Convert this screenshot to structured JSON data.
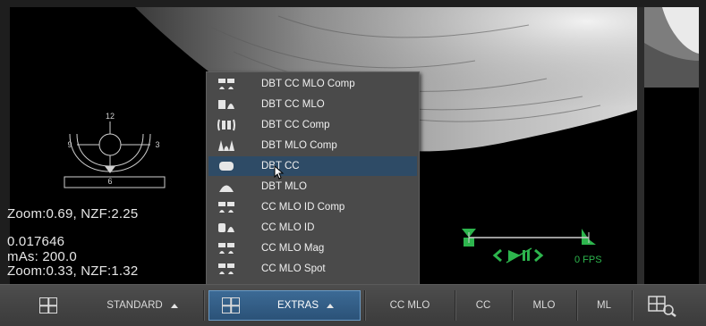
{
  "viewer": {
    "overlay": {
      "zoom_top": "Zoom:0.69, NZF:2.25",
      "value": "0.017646",
      "mas": "mAs: 200.0",
      "zoom_bottom": "Zoom:0.33, NZF:1.32"
    },
    "orientation": {
      "label_12": "12",
      "label_9": "9",
      "label_3": "3",
      "label_6": "6"
    },
    "cine": {
      "fps": "0 FPS",
      "accent": "#2db54d"
    }
  },
  "menu": {
    "highlight_color": "#2e4b66",
    "items": [
      {
        "label": "DBT CC MLO Comp",
        "icon": "hanging-protocol-icon"
      },
      {
        "label": "DBT CC MLO",
        "icon": "hanging-protocol-icon"
      },
      {
        "label": "DBT CC Comp",
        "icon": "hanging-protocol-icon"
      },
      {
        "label": "DBT MLO Comp",
        "icon": "hanging-protocol-icon"
      },
      {
        "label": "DBT CC",
        "icon": "hanging-protocol-icon",
        "highlighted": true
      },
      {
        "label": "DBT MLO",
        "icon": "hanging-protocol-icon"
      },
      {
        "label": "CC MLO ID Comp",
        "icon": "hanging-protocol-icon"
      },
      {
        "label": "CC MLO ID",
        "icon": "hanging-protocol-icon"
      },
      {
        "label": "CC MLO Mag",
        "icon": "hanging-protocol-icon"
      },
      {
        "label": "CC MLO Spot",
        "icon": "hanging-protocol-icon"
      }
    ]
  },
  "toolbar": {
    "standard_label": "STANDARD",
    "extras_label": "EXTRAS",
    "cc_mlo_label": "CC MLO",
    "cc_label": "CC",
    "mlo_label": "MLO",
    "ml_label": "ML",
    "active_color": "#2b5278"
  }
}
